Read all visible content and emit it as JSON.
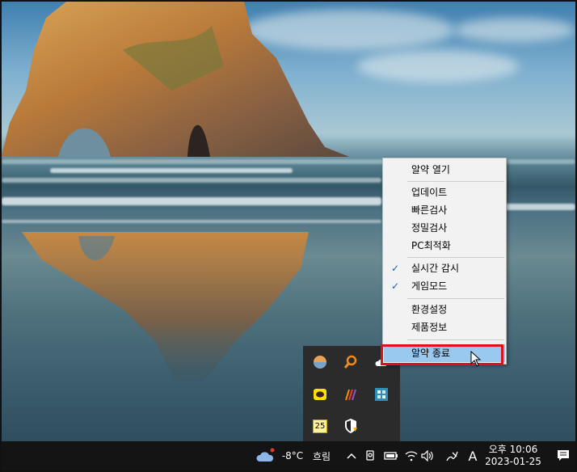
{
  "context_menu": {
    "items": [
      {
        "label": "알약 열기",
        "checked": false
      },
      {
        "label": "업데이트",
        "checked": false
      },
      {
        "label": "빠른검사",
        "checked": false
      },
      {
        "label": "정밀검사",
        "checked": false
      },
      {
        "label": "PC최적화",
        "checked": false
      },
      {
        "label": "실시간 감시",
        "checked": true
      },
      {
        "label": "게임모드",
        "checked": true
      },
      {
        "label": "환경설정",
        "checked": false
      },
      {
        "label": "제품정보",
        "checked": false
      },
      {
        "label": "알약 종료",
        "checked": false,
        "highlighted": true
      }
    ],
    "check_glyph": "✓",
    "highlight_color": "#e0101f",
    "hover_color": "#99c9ef"
  },
  "tray_flyout": {
    "icons": [
      {
        "name": "weather-app-icon"
      },
      {
        "name": "search-magnifier-icon"
      },
      {
        "name": "cloud-icon"
      },
      {
        "name": "kakaotalk-icon"
      },
      {
        "name": "stripes-app-icon"
      },
      {
        "name": "grid-app-icon"
      },
      {
        "name": "calendar-icon",
        "text": "25"
      },
      {
        "name": "alyac-shield-icon"
      }
    ]
  },
  "taskbar": {
    "weather": {
      "temperature": "-8°C",
      "condition": "흐림"
    },
    "input_indicator": "A",
    "clock": {
      "time": "오후 10:06",
      "date": "2023-01-25"
    },
    "icons": [
      "chevron-up-icon",
      "meet-now-icon",
      "battery-icon",
      "wifi-icon",
      "volume-icon",
      "pen-icon",
      "ime-icon",
      "notification-icon"
    ]
  }
}
